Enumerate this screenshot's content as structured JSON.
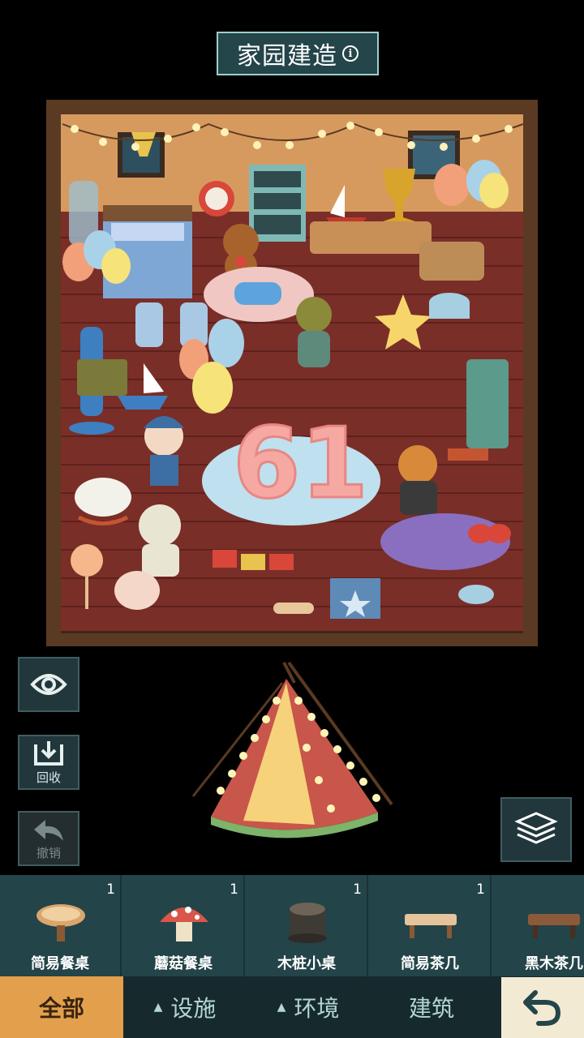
{
  "header": {
    "title": "家园建造",
    "info_icon": "info-icon"
  },
  "room": {
    "balloon_number": "61"
  },
  "side_buttons": [
    {
      "name": "preview",
      "icon": "eye-icon",
      "label": ""
    },
    {
      "name": "recycle",
      "icon": "recycle-icon",
      "label": "回收"
    },
    {
      "name": "undo",
      "icon": "undo-icon",
      "label": "撤销",
      "disabled": true
    }
  ],
  "layers_icon": "layers-icon",
  "items": [
    {
      "name": "简易餐桌",
      "count": "1"
    },
    {
      "name": "蘑菇餐桌",
      "count": "1"
    },
    {
      "name": "木桩小桌",
      "count": "1"
    },
    {
      "name": "简易茶几",
      "count": "1"
    },
    {
      "name": "黑木茶几",
      "count": ""
    }
  ],
  "tabs": [
    {
      "label": "全部",
      "active": true
    },
    {
      "label": "设施",
      "caret": "▲"
    },
    {
      "label": "环境",
      "caret": "▲"
    },
    {
      "label": "建筑"
    }
  ],
  "back_icon": "return-icon",
  "colors": {
    "panel": "#234449",
    "active_tab": "#e3a04c",
    "back_button": "#f2ead3"
  }
}
